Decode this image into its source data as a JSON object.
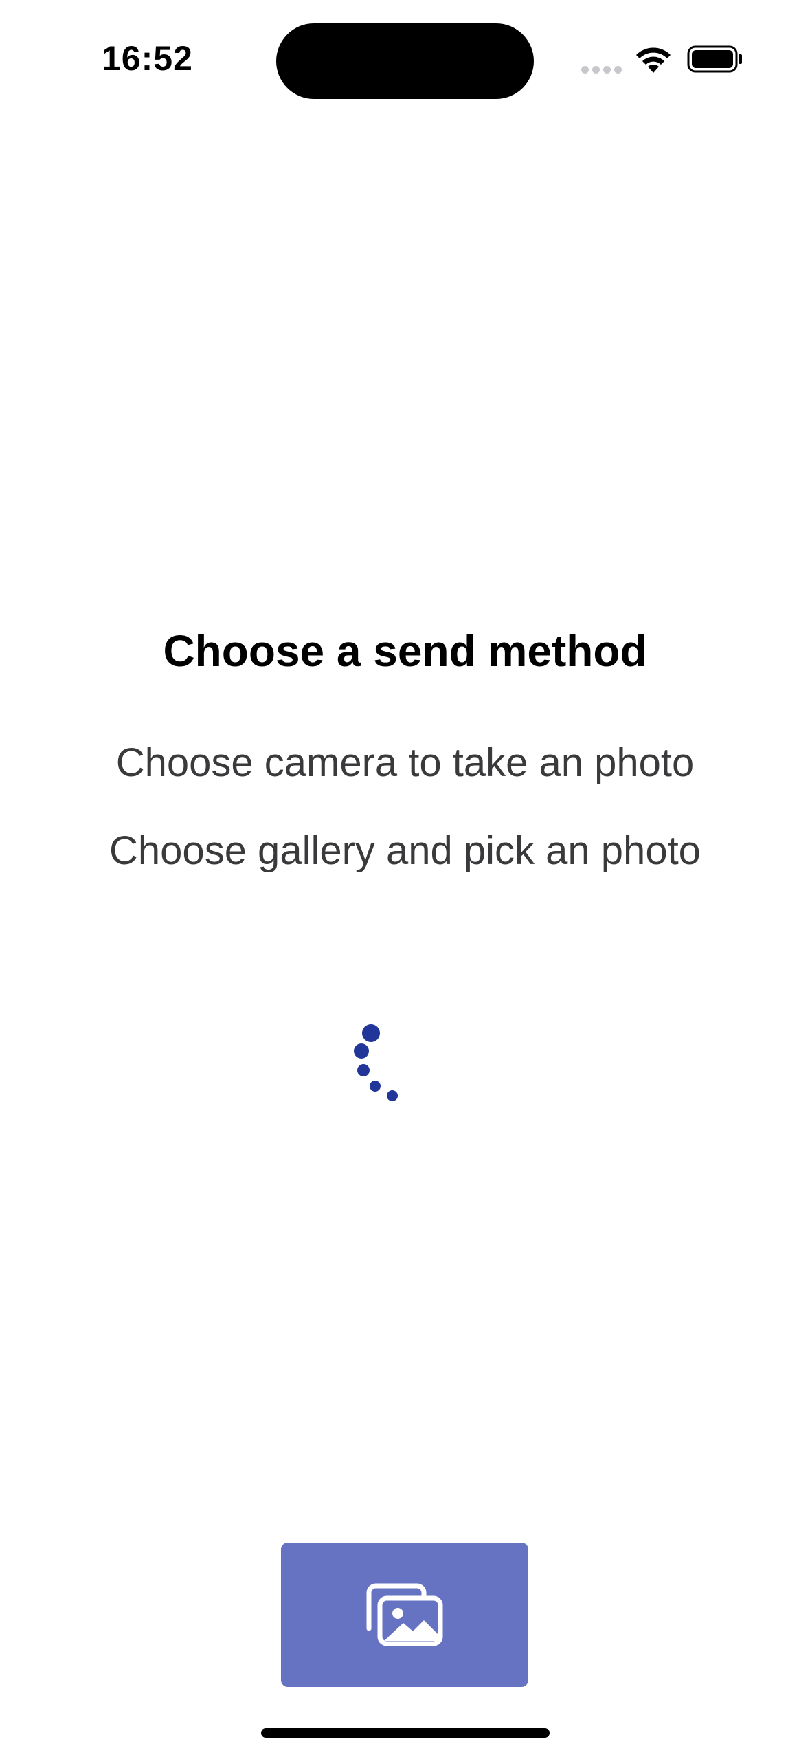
{
  "status_bar": {
    "time": "16:52",
    "cellular_icon": "cellular-dots-icon",
    "wifi_icon": "wifi-icon",
    "battery_icon": "battery-icon"
  },
  "content": {
    "title": "Choose a send method",
    "instructions": [
      "Choose camera to take an photo",
      "Choose gallery and pick an photo"
    ],
    "loading_indicator": "loading-spinner-icon"
  },
  "actions": {
    "gallery_button_icon": "gallery-icon",
    "gallery_button_color": "#6673c2"
  },
  "colors": {
    "accent": "#22369a",
    "button": "#6673c2",
    "text_primary": "#000000",
    "text_secondary": "#3a3a3c",
    "background": "#ffffff"
  }
}
